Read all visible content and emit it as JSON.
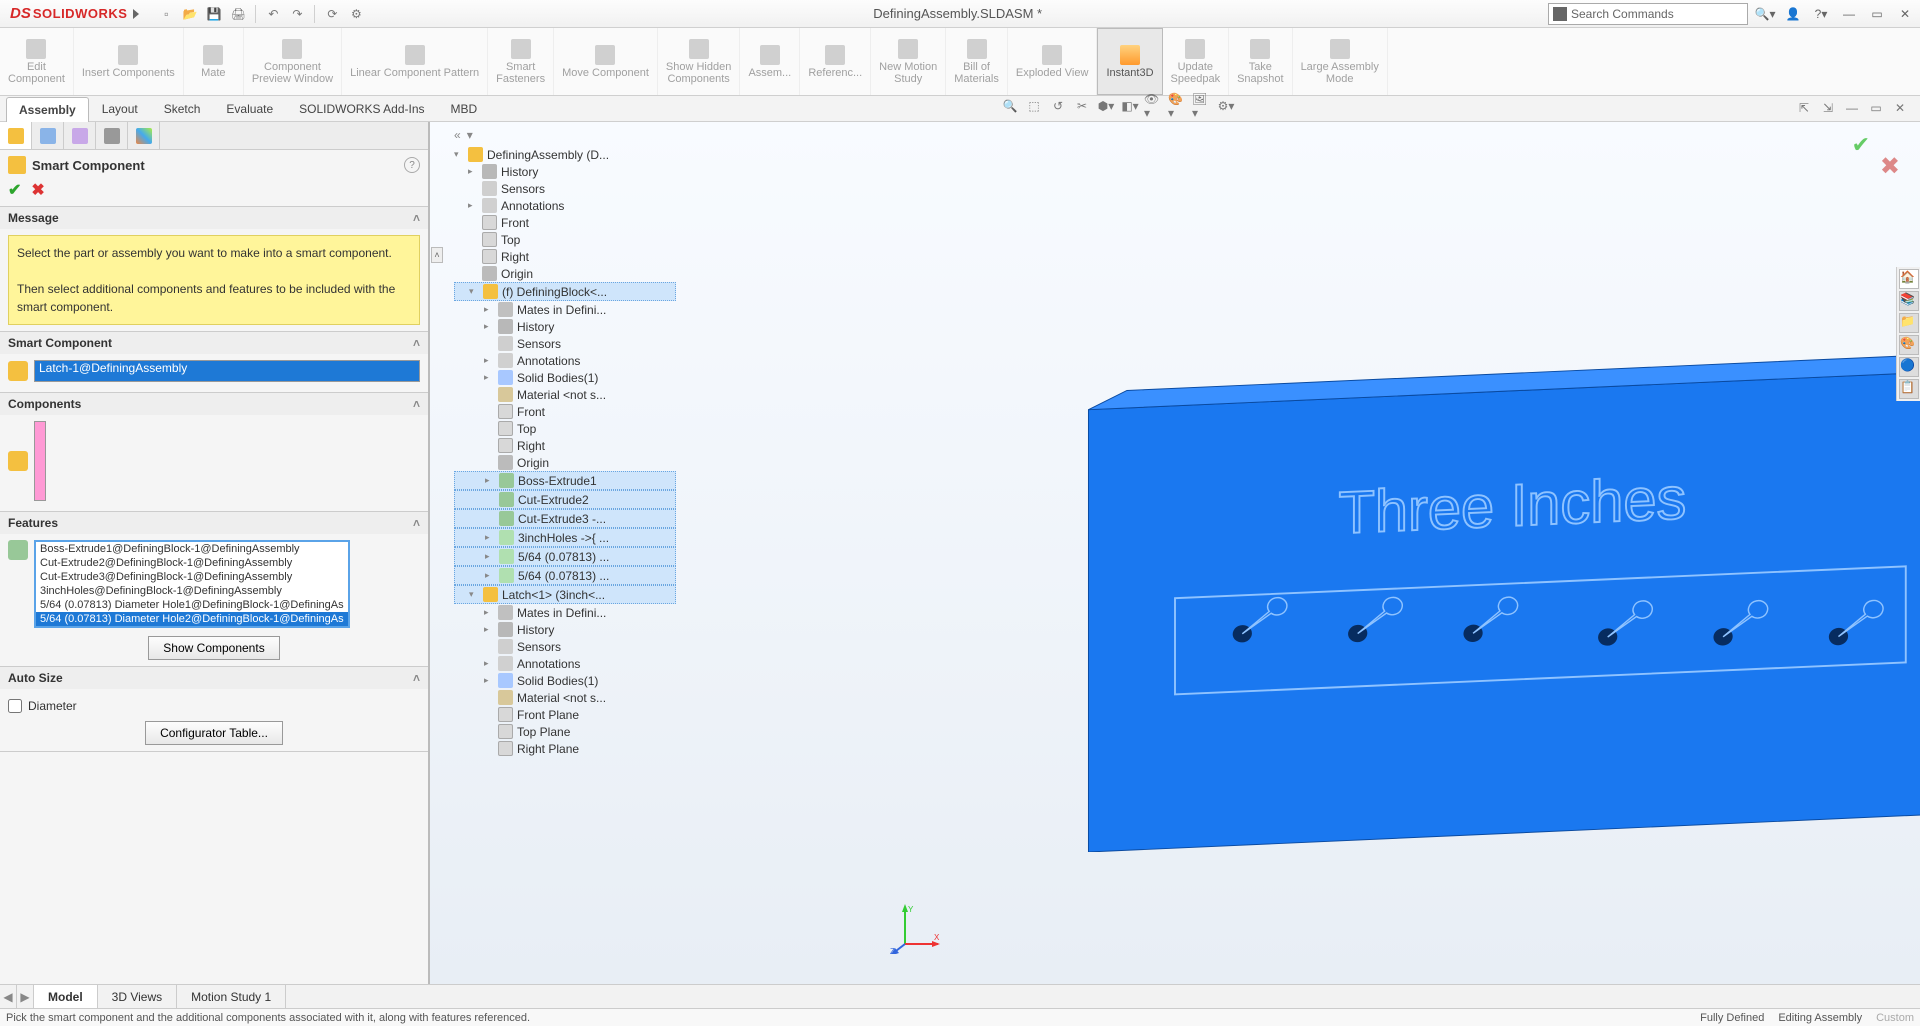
{
  "title": "DefiningAssembly.SLDASM *",
  "logo": {
    "ds": "DS",
    "sw": "SOLIDWORKS"
  },
  "search_placeholder": "Search Commands",
  "ribbon": [
    {
      "label": "Edit\nComponent"
    },
    {
      "label": "Insert Components"
    },
    {
      "label": "Mate"
    },
    {
      "label": "Component\nPreview Window"
    },
    {
      "label": "Linear Component Pattern"
    },
    {
      "label": "Smart\nFasteners"
    },
    {
      "label": "Move Component"
    },
    {
      "label": "Show Hidden\nComponents"
    },
    {
      "label": "Assem..."
    },
    {
      "label": "Referenc..."
    },
    {
      "label": "New Motion\nStudy"
    },
    {
      "label": "Bill of\nMaterials"
    },
    {
      "label": "Exploded View"
    },
    {
      "label": "Instant3D",
      "active": true
    },
    {
      "label": "Update\nSpeedpak"
    },
    {
      "label": "Take\nSnapshot"
    },
    {
      "label": "Large Assembly\nMode"
    }
  ],
  "ribbon_tabs": [
    "Assembly",
    "Layout",
    "Sketch",
    "Evaluate",
    "SOLIDWORKS Add-Ins",
    "MBD"
  ],
  "ribbon_tabs_active": 0,
  "prop": {
    "title": "Smart Component",
    "sections": {
      "message_head": "Message",
      "message_p1": "Select the part or assembly you want to make into a smart component.",
      "message_p2": "Then select additional components and features to be included with the smart component.",
      "smart_head": "Smart Component",
      "smart_value": "Latch-1@DefiningAssembly",
      "components_head": "Components",
      "features_head": "Features",
      "features_items": [
        "Boss-Extrude1@DefiningBlock-1@DefiningAssembly",
        "Cut-Extrude2@DefiningBlock-1@DefiningAssembly",
        "Cut-Extrude3@DefiningBlock-1@DefiningAssembly",
        "3inchHoles@DefiningBlock-1@DefiningAssembly",
        "5/64 (0.07813) Diameter Hole1@DefiningBlock-1@DefiningAs",
        "5/64 (0.07813) Diameter Hole2@DefiningBlock-1@DefiningAs"
      ],
      "show_components_btn": "Show Components",
      "autosize_head": "Auto Size",
      "diameter_chk": "Diameter",
      "config_btn": "Configurator Table..."
    }
  },
  "tree": [
    {
      "lvl": 0,
      "icon": "ic-asm",
      "caret": "▾",
      "label": "DefiningAssembly  (D..."
    },
    {
      "lvl": 1,
      "icon": "ic-hist",
      "caret": "▸",
      "label": "History"
    },
    {
      "lvl": 1,
      "icon": "ic-sens",
      "caret": "",
      "label": "Sensors"
    },
    {
      "lvl": 1,
      "icon": "ic-annot",
      "caret": "▸",
      "label": "Annotations"
    },
    {
      "lvl": 1,
      "icon": "ic-plane",
      "caret": "",
      "label": "Front"
    },
    {
      "lvl": 1,
      "icon": "ic-plane",
      "caret": "",
      "label": "Top"
    },
    {
      "lvl": 1,
      "icon": "ic-plane",
      "caret": "",
      "label": "Right"
    },
    {
      "lvl": 1,
      "icon": "ic-orig",
      "caret": "",
      "label": "Origin"
    },
    {
      "lvl": 1,
      "icon": "ic-part",
      "caret": "▾",
      "label": "(f) DefiningBlock<...",
      "sel": true
    },
    {
      "lvl": 2,
      "icon": "ic-mate",
      "caret": "▸",
      "label": "Mates in Defini..."
    },
    {
      "lvl": 2,
      "icon": "ic-hist",
      "caret": "▸",
      "label": "History"
    },
    {
      "lvl": 2,
      "icon": "ic-sens",
      "caret": "",
      "label": "Sensors"
    },
    {
      "lvl": 2,
      "icon": "ic-annot",
      "caret": "▸",
      "label": "Annotations"
    },
    {
      "lvl": 2,
      "icon": "ic-body",
      "caret": "▸",
      "label": "Solid Bodies(1)"
    },
    {
      "lvl": 2,
      "icon": "ic-mat",
      "caret": "",
      "label": "Material <not s..."
    },
    {
      "lvl": 2,
      "icon": "ic-plane",
      "caret": "",
      "label": "Front"
    },
    {
      "lvl": 2,
      "icon": "ic-plane",
      "caret": "",
      "label": "Top"
    },
    {
      "lvl": 2,
      "icon": "ic-plane",
      "caret": "",
      "label": "Right"
    },
    {
      "lvl": 2,
      "icon": "ic-orig",
      "caret": "",
      "label": "Origin"
    },
    {
      "lvl": 2,
      "icon": "ic-feat",
      "caret": "▸",
      "label": "Boss-Extrude1",
      "sel": true
    },
    {
      "lvl": 2,
      "icon": "ic-feat",
      "caret": "",
      "label": "Cut-Extrude2",
      "sel": true
    },
    {
      "lvl": 2,
      "icon": "ic-feat",
      "caret": "",
      "label": "Cut-Extrude3 -...",
      "sel": true
    },
    {
      "lvl": 2,
      "icon": "ic-hole",
      "caret": "▸",
      "label": "3inchHoles ->{ ...",
      "sel": true
    },
    {
      "lvl": 2,
      "icon": "ic-hole",
      "caret": "▸",
      "label": "5/64 (0.07813) ...",
      "sel": true
    },
    {
      "lvl": 2,
      "icon": "ic-hole",
      "caret": "▸",
      "label": "5/64 (0.07813) ...",
      "sel": true
    },
    {
      "lvl": 1,
      "icon": "ic-part",
      "caret": "▾",
      "label": "Latch<1> (3inch<...",
      "sel": true
    },
    {
      "lvl": 2,
      "icon": "ic-mate",
      "caret": "▸",
      "label": "Mates in Defini..."
    },
    {
      "lvl": 2,
      "icon": "ic-hist",
      "caret": "▸",
      "label": "History"
    },
    {
      "lvl": 2,
      "icon": "ic-sens",
      "caret": "",
      "label": "Sensors"
    },
    {
      "lvl": 2,
      "icon": "ic-annot",
      "caret": "▸",
      "label": "Annotations"
    },
    {
      "lvl": 2,
      "icon": "ic-body",
      "caret": "▸",
      "label": "Solid Bodies(1)"
    },
    {
      "lvl": 2,
      "icon": "ic-mat",
      "caret": "",
      "label": "Material <not s..."
    },
    {
      "lvl": 2,
      "icon": "ic-plane",
      "caret": "",
      "label": "Front Plane"
    },
    {
      "lvl": 2,
      "icon": "ic-plane",
      "caret": "",
      "label": "Top Plane"
    },
    {
      "lvl": 2,
      "icon": "ic-plane",
      "caret": "",
      "label": "Right Plane"
    }
  ],
  "model_text": "Three Inches",
  "bottom_tabs": [
    "Model",
    "3D Views",
    "Motion Study 1"
  ],
  "bottom_tabs_active": 0,
  "status": {
    "hint": "Pick the smart component and the additional components associated with it, along with features referenced.",
    "def": "Fully Defined",
    "mode": "Editing Assembly",
    "custom": "Custom"
  }
}
